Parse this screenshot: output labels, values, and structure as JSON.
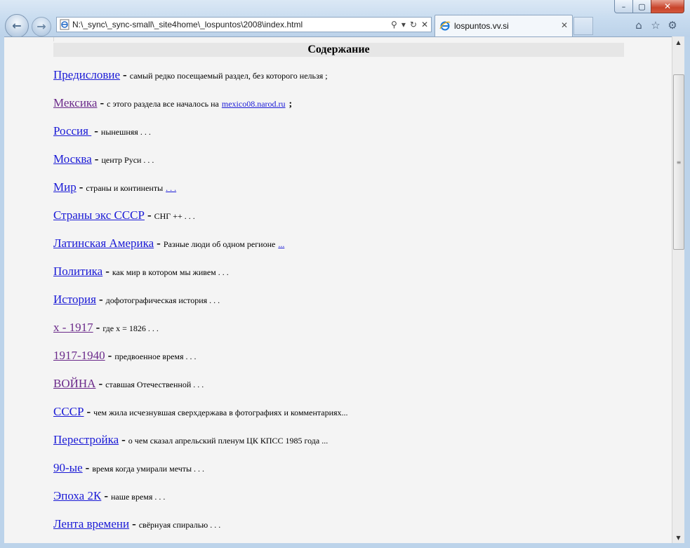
{
  "browser": {
    "address_url": "N:\\_sync\\_sync-small\\_site4home\\_lospuntos\\2008\\index.html",
    "tab_title": "lospuntos.vv.si"
  },
  "page": {
    "header": "Содержание",
    "items": [
      {
        "link": "Предисловие",
        "dash": "-",
        "desc": "самый редко посещаемый раздел, без которого нельзя ;"
      },
      {
        "link": "Мексика",
        "dash": "-",
        "desc": "с этого раздела все началось на",
        "extra_link": "mexico08.narod.ru",
        "tail": ";"
      },
      {
        "link": "Россия ",
        "dash": "-",
        "desc": "нынешняя . . ."
      },
      {
        "link": "Москва",
        "dash": "-",
        "desc": "центр Руси . . ."
      },
      {
        "link": "Мир",
        "dash": "-",
        "desc": "страны и континенты",
        "extra_link": ". . ."
      },
      {
        "link": "Страны экс СССР",
        "dash": "-",
        "desc": "СНГ ++ . . ."
      },
      {
        "link": "Латинская Америка",
        "dash": "-",
        "desc": "Разные люди об одном регионе",
        "extra_link": "..."
      },
      {
        "link": "Политика",
        "dash": "-",
        "desc": "как мир в котором мы живем . . ."
      },
      {
        "link": "История",
        "dash": "-",
        "desc": "дофотографическая история . . ."
      },
      {
        "link": "x - 1917",
        "dash": "-",
        "desc": "где x =  1826 . . ."
      },
      {
        "link": "1917-1940",
        "dash": "-",
        "desc": "предвоенное время . . ."
      },
      {
        "link": "ВОЙНА",
        "dash": "-",
        "desc": "ставшая Отечественной . . ."
      },
      {
        "link": "СССР",
        "dash": "-",
        "desc": "чем жила исчезнувшая сверхдержава в фотографиях и комментариях..."
      },
      {
        "link": "Перестройка",
        "dash": "-",
        "desc": "о чем сказал апрельский пленум ЦК КПСС 1985 года   ..."
      },
      {
        "link": "90-ые",
        "dash": "-",
        "desc": "время когда умирали мечты . . ."
      },
      {
        "link": "Эпоха 2К",
        "dash": "-",
        "desc": "наше время . . ."
      },
      {
        "link": "Лента времени",
        "dash": "-",
        "desc": "свёрнуая спиралью . . ."
      }
    ]
  }
}
